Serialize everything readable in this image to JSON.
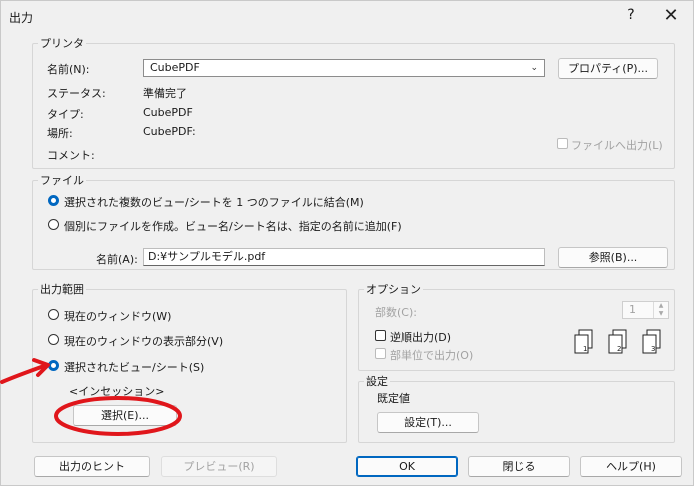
{
  "window": {
    "title": "出力",
    "help": "?",
    "close": "✕"
  },
  "printer": {
    "legend": "プリンタ",
    "name_label": "名前(N):",
    "name_value": "CubePDF",
    "properties_btn": "プロパティ(P)...",
    "status_label": "ステータス:",
    "status_value": "準備完了",
    "type_label": "タイプ:",
    "type_value": "CubePDF",
    "location_label": "場所:",
    "location_value": "CubePDF:",
    "comment_label": "コメント:",
    "print_to_file": "ファイルへ出力(L)"
  },
  "file": {
    "legend": "ファイル",
    "option_combine": "選択された複数のビュー/シートを 1 つのファイルに結合(M)",
    "option_separate": "個別にファイルを作成。ビュー名/シート名は、指定の名前に追加(F)",
    "name_label": "名前(A):",
    "name_value": "D:¥サンプルモデル.pdf",
    "browse_btn": "参照(B)..."
  },
  "range": {
    "legend": "出力範囲",
    "opt_current_window": "現在のウィンドウ(W)",
    "opt_visible_portion": "現在のウィンドウの表示部分(V)",
    "opt_selected": "選択されたビュー/シート(S)",
    "set_name": "<インセッション>",
    "select_btn": "選択(E)..."
  },
  "options": {
    "legend": "オプション",
    "copies_label": "部数(C):",
    "copies_value": "1",
    "reverse_order": "逆順出力(D)",
    "collate": "部単位で出力(O)"
  },
  "settings": {
    "legend": "設定",
    "current_value": "既定値",
    "settings_btn": "設定(T)..."
  },
  "footer": {
    "hint_btn": "出力のヒント",
    "preview_btn": "プレビュー(R)",
    "ok_btn": "OK",
    "close_btn": "閉じる",
    "help_btn": "ヘルプ(H)"
  },
  "annotations": {
    "highlight_color": "#e0161b"
  }
}
